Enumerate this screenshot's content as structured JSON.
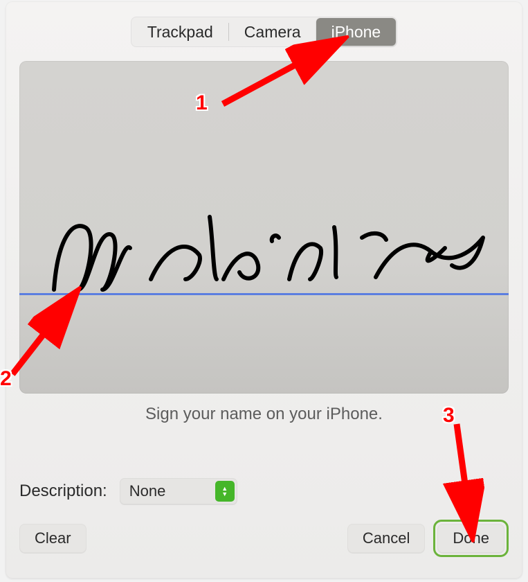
{
  "segmented": {
    "options": [
      "Trackpad",
      "Camera",
      "iPhone"
    ],
    "selected_index": 2
  },
  "instruction": "Sign your name on your iPhone.",
  "description": {
    "label": "Description:",
    "selected": "None"
  },
  "buttons": {
    "clear": "Clear",
    "cancel": "Cancel",
    "done": "Done"
  },
  "annotations": {
    "n1": "1",
    "n2": "2",
    "n3": "3"
  },
  "colors": {
    "accent_green": "#6bb33b",
    "arrow_red": "#ff0000",
    "sig_line": "#5b7ee0"
  }
}
